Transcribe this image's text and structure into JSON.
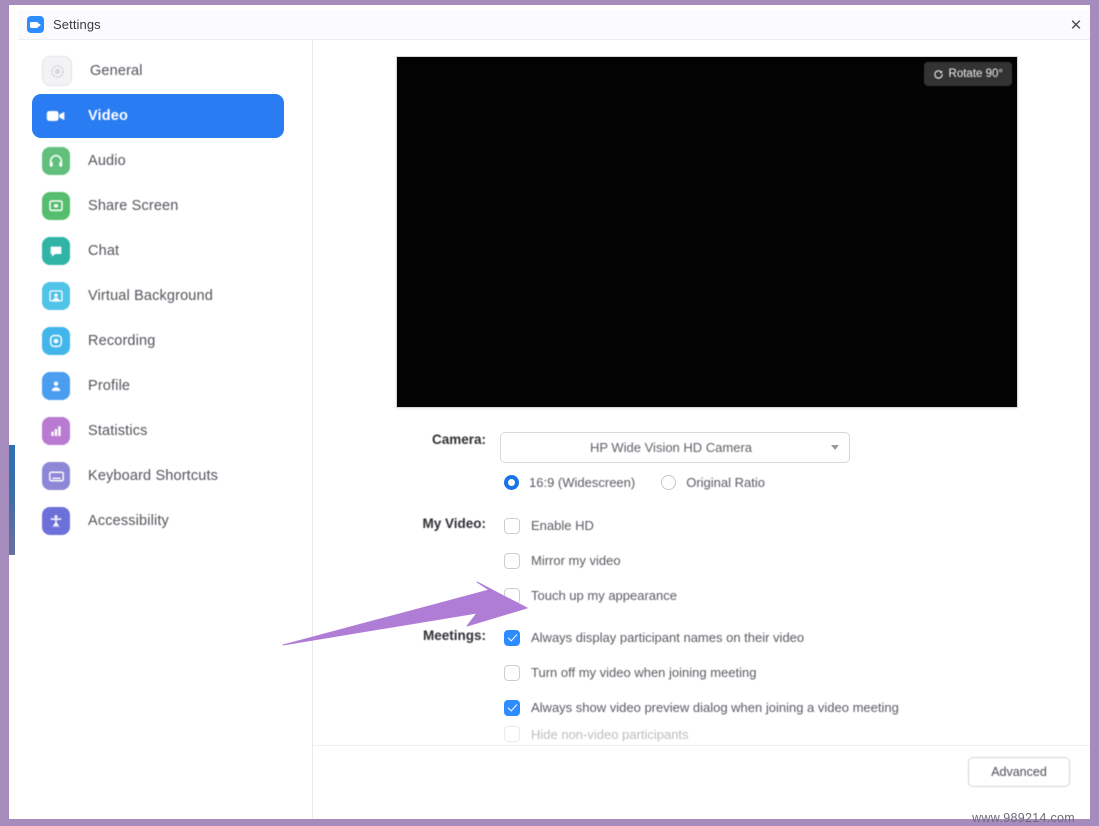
{
  "window": {
    "title": "Settings",
    "app_icon": "zoom-logo-icon",
    "close_icon": "✕",
    "border_color": "#a68bbd"
  },
  "sidebar": {
    "items": [
      {
        "label": "General",
        "icon": "gear-icon",
        "color": "#f2f2f4",
        "active": false
      },
      {
        "label": "Video",
        "icon": "video-camera-icon",
        "color": "#2a7cf2",
        "active": true
      },
      {
        "label": "Audio",
        "icon": "headphones-icon",
        "color": "#62c07c",
        "active": false
      },
      {
        "label": "Share Screen",
        "icon": "share-screen-icon",
        "color": "#57bd6e",
        "active": false
      },
      {
        "label": "Chat",
        "icon": "chat-bubble-icon",
        "color": "#2fb4a6",
        "active": false
      },
      {
        "label": "Virtual Background",
        "icon": "virtual-background-icon",
        "color": "#4fc3e8",
        "active": false
      },
      {
        "label": "Recording",
        "icon": "record-icon",
        "color": "#42b6ea",
        "active": false
      },
      {
        "label": "Profile",
        "icon": "profile-person-icon",
        "color": "#4b9df0",
        "active": false
      },
      {
        "label": "Statistics",
        "icon": "bar-chart-icon",
        "color": "#b97ad1",
        "active": false
      },
      {
        "label": "Keyboard Shortcuts",
        "icon": "keyboard-icon",
        "color": "#8e86d6",
        "active": false
      },
      {
        "label": "Accessibility",
        "icon": "accessibility-icon",
        "color": "#6d70d8",
        "active": false
      }
    ]
  },
  "video_preview": {
    "rotate_button_label": "Rotate 90°",
    "rotate_icon": "rotate-icon",
    "background_color": "#030303"
  },
  "settings": {
    "camera": {
      "label": "Camera:",
      "selected_device": "HP Wide Vision HD Camera",
      "options": [
        "HP Wide Vision HD Camera"
      ],
      "aspect_ratio": [
        {
          "label": "16:9 (Widescreen)",
          "checked": true
        },
        {
          "label": "Original Ratio",
          "checked": false
        }
      ]
    },
    "my_video": {
      "label": "My Video:",
      "checkboxes": [
        {
          "label": "Enable HD",
          "checked": false
        },
        {
          "label": "Mirror my video",
          "checked": false
        },
        {
          "label": "Touch up my appearance",
          "checked": false
        }
      ]
    },
    "meetings": {
      "label": "Meetings:",
      "checkboxes": [
        {
          "label": "Always display participant names on their video",
          "checked": true,
          "cutoff": false
        },
        {
          "label": "Turn off my video when joining meeting",
          "checked": false,
          "cutoff": false
        },
        {
          "label": "Always show video preview dialog when joining a video meeting",
          "checked": true,
          "cutoff": false
        },
        {
          "label": "Hide non-video participants",
          "checked": false,
          "cutoff": true
        }
      ]
    }
  },
  "footer": {
    "advanced_label": "Advanced"
  },
  "watermark": "www.989214.com",
  "annotation": {
    "arrow_color": "#b07dd6",
    "points_to": "Touch up my appearance"
  }
}
